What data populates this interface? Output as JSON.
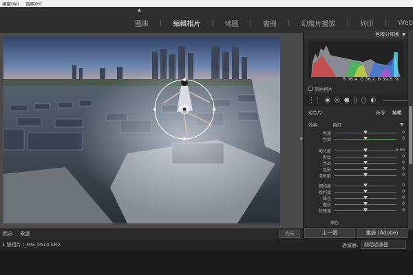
{
  "menu": {
    "items": [
      "視窗(W)",
      "說明(H)"
    ]
  },
  "modules": [
    {
      "label": "圖庫",
      "active": false
    },
    {
      "label": "編輯相片",
      "active": true
    },
    {
      "label": "地圖",
      "active": false
    },
    {
      "label": "書冊",
      "active": false
    },
    {
      "label": "幻燈片播放",
      "active": false
    },
    {
      "label": "列印",
      "active": false
    },
    {
      "label": "Web",
      "active": false
    }
  ],
  "toolbar": {
    "mark_label": "標記:",
    "mark_value": "永遠",
    "done_label": "完成"
  },
  "histogram": {
    "title": "色階分佈圖",
    "readout": {
      "r": "R 36.4",
      "g": "G 36.2",
      "b": "B 39.6",
      "unit": "%"
    },
    "original_photo_label": "原始相片"
  },
  "mask": {
    "label": "遮色片:",
    "new": "新增",
    "edit": "編輯"
  },
  "effect": {
    "label": "效果:",
    "value": "自訂"
  },
  "sliders": [
    {
      "label": "色溫",
      "value": "0",
      "pos": 0.5,
      "color": "#5a8fd0"
    },
    {
      "label": "色調",
      "value": "0",
      "pos": 0.5,
      "color": "#7ac070"
    },
    {
      "label": "曝光度",
      "value": "0.00",
      "pos": 0.5
    },
    {
      "label": "對比",
      "value": "0",
      "pos": 0.5
    },
    {
      "label": "亮部",
      "value": "0",
      "pos": 0.5
    },
    {
      "label": "陰影",
      "value": "0",
      "pos": 0.5
    },
    {
      "label": "清晰度",
      "value": "0",
      "pos": 0.5
    },
    {
      "label": "飽和度",
      "value": "0",
      "pos": 0.5
    },
    {
      "label": "銳利度",
      "value": "0",
      "pos": 0.5
    },
    {
      "label": "雜色",
      "value": "0",
      "pos": 0.5
    },
    {
      "label": "疊紋",
      "value": "0",
      "pos": 0.5
    },
    {
      "label": "除鏡邊",
      "value": "0",
      "pos": 0.5
    }
  ],
  "color_label": "顏色",
  "panel_buttons": {
    "prev": "上一個",
    "reset": "重設 (Adobe)"
  },
  "filmstrip": {
    "title": "1 張相片 /_MG_5614.CR2",
    "filter_label": "過濾器:",
    "filter_value": "關閉過濾器"
  }
}
